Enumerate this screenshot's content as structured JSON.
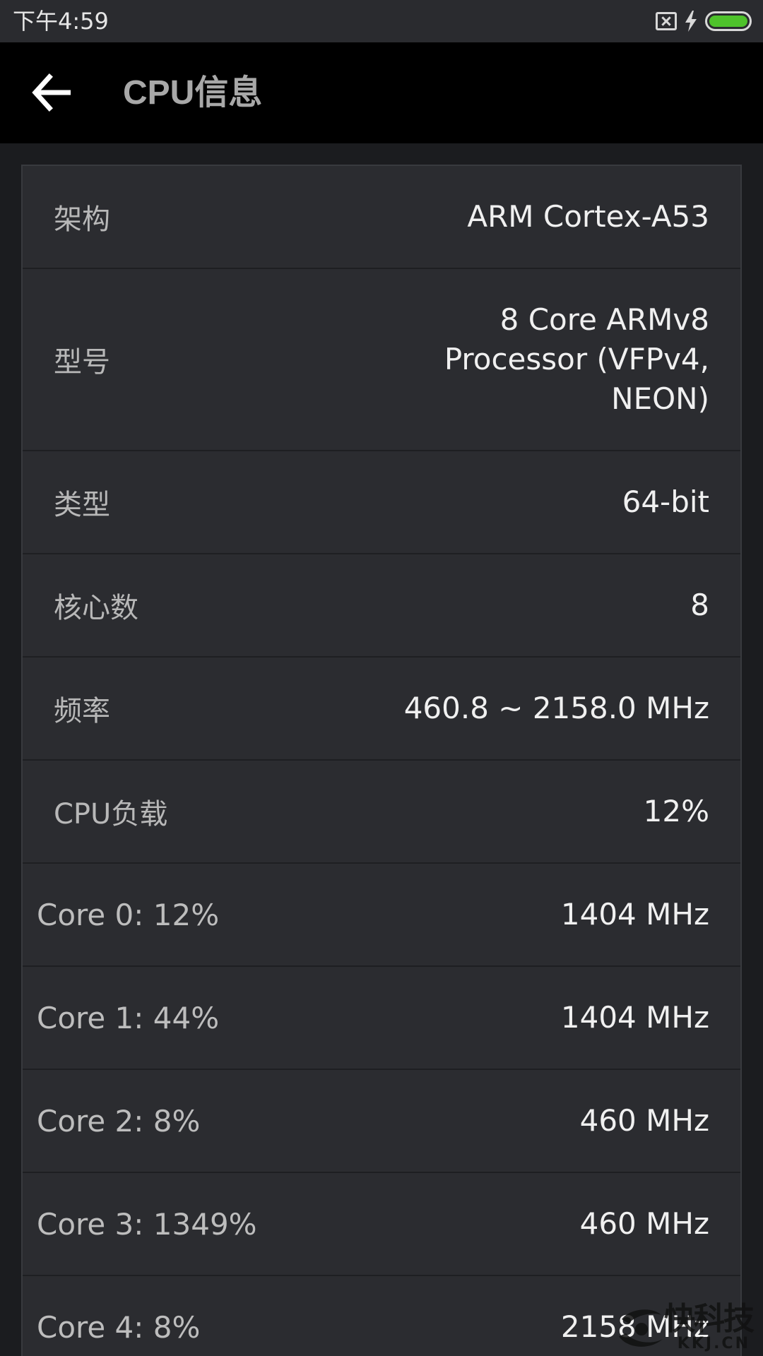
{
  "status_bar": {
    "time": "下午4:59",
    "icons": [
      "sim-absent-icon",
      "charging-bolt-icon",
      "battery-icon"
    ],
    "battery_level": 1.0,
    "battery_color": "#4ec22b"
  },
  "app_bar": {
    "title": "CPU信息",
    "back_icon": "back-arrow-icon"
  },
  "info_rows": [
    {
      "label": "架构",
      "value": "ARM Cortex-A53"
    },
    {
      "label": "型号",
      "value": "8 Core ARMv8 Processor (VFPv4, NEON)"
    },
    {
      "label": "类型",
      "value": "64-bit"
    },
    {
      "label": "核心数",
      "value": "8"
    },
    {
      "label": "频率",
      "value": "460.8 ~ 2158.0 MHz"
    },
    {
      "label": "CPU负载",
      "value": "12%"
    }
  ],
  "core_rows": [
    {
      "label": "Core 0: 12%",
      "value": "1404 MHz"
    },
    {
      "label": "Core 1: 44%",
      "value": "1404 MHz"
    },
    {
      "label": "Core 2: 8%",
      "value": "460 MHz"
    },
    {
      "label": "Core 3: 1349%",
      "value": "460 MHz"
    },
    {
      "label": "Core 4: 8%",
      "value": "2158 MHz"
    }
  ],
  "watermark": {
    "cn": "快科技",
    "en": "KKJ.CN"
  }
}
